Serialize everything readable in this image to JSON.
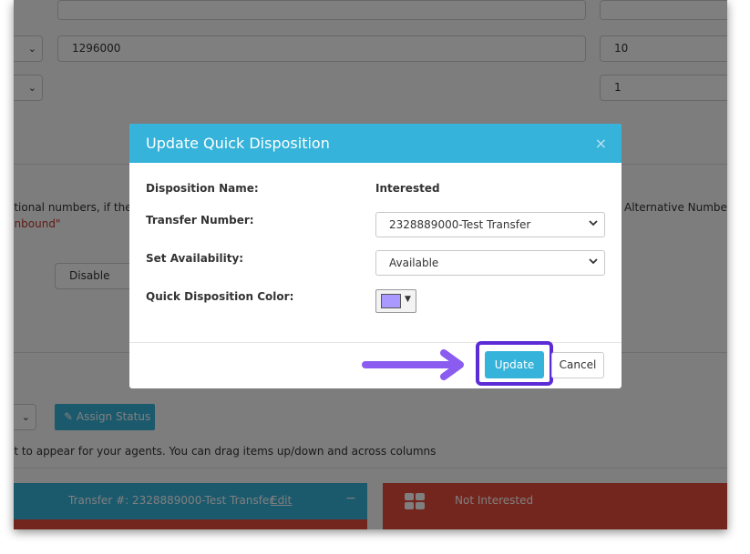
{
  "background": {
    "row1_input_value": "1296000",
    "row1_right_value": "10",
    "row2_right_value": "1",
    "info_text_left": "itional numbers, if the l",
    "info_text_right": "Alternative Numbers",
    "info_inbound": "Inbound\"",
    "disable_label": "Disable",
    "assign_status_label": "Assign Status",
    "drag_hint": "it to appear for your agents. You can drag items up/down and across columns",
    "card_left_transfer": "Transfer #: 2328889000-Test Transfer",
    "card_left_edit": "Edit",
    "card_left_collapse": "−",
    "card_right_label": "Not Interested"
  },
  "modal": {
    "title": "Update Quick Disposition",
    "close_symbol": "×",
    "disposition_name_label": "Disposition Name:",
    "disposition_name_value": "Interested",
    "transfer_number_label": "Transfer Number:",
    "transfer_number_value": "2328889000-Test Transfer",
    "availability_label": "Set Availability:",
    "availability_value": "Available",
    "color_label": "Quick Disposition Color:",
    "color_value": "#aa99ff",
    "update_label": "Update",
    "cancel_label": "Cancel"
  },
  "colors": {
    "header_blue": "#36b3da",
    "highlight_purple": "#5b2bd6",
    "card_left": "#36b3da",
    "card_right": "#e74c3c",
    "assign_button": "#36b3da"
  }
}
